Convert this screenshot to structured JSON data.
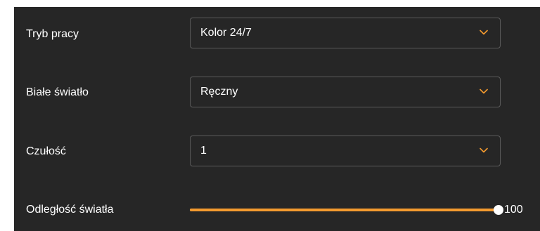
{
  "settings": {
    "mode": {
      "label": "Tryb pracy",
      "value": "Kolor 24/7"
    },
    "white_light": {
      "label": "Białe światło",
      "value": "Ręczny"
    },
    "sensitivity": {
      "label": "Czułość",
      "value": "1"
    },
    "light_distance": {
      "label": "Odległość światła",
      "value": "100",
      "level": 1.0
    }
  },
  "icons": {
    "dropdown": "chevron-down-icon"
  },
  "colors": {
    "panel_bg": "#262626",
    "accent": "#f39a2f",
    "border": "#5b5b5b",
    "text": "#ffffff"
  }
}
